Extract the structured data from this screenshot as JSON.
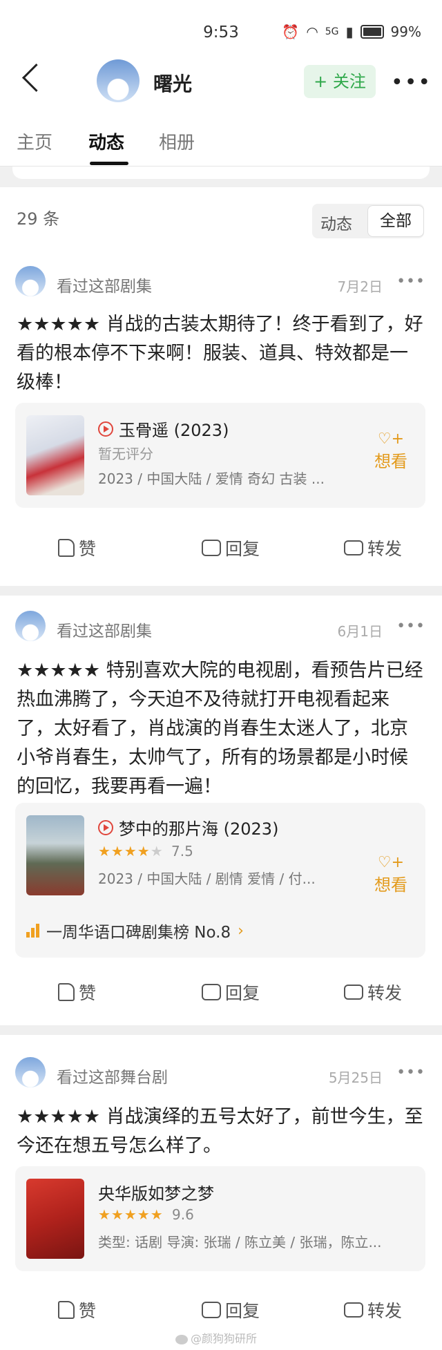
{
  "status_bar": {
    "time": "9:53",
    "signal": "5G",
    "battery": "99%"
  },
  "header": {
    "name": "曙光",
    "follow_label": "+ 关注",
    "tabs": [
      {
        "label": "主页"
      },
      {
        "label": "动态"
      },
      {
        "label": "相册"
      }
    ],
    "active_tab": "动态"
  },
  "feed": {
    "count": "29 条",
    "filters": {
      "option_1": "动态",
      "option_2": "全部"
    }
  },
  "posts": [
    {
      "action": "看过这部剧集",
      "date": "7月2日",
      "text": "★★★★★ 肖战的古装太期待了！终于看到了，好看的根本停不下来啊！服装、道具、特效都是一级棒！",
      "card": {
        "title": "玉骨遥 (2023)",
        "rating_text": "暂无评分",
        "info": "2023 / 中国大陆 / 爱情 奇幻 古装 ...",
        "want_label": "想看"
      },
      "actions": {
        "like": "赞",
        "reply": "回复",
        "share": "转发"
      }
    },
    {
      "action": "看过这部剧集",
      "date": "6月1日",
      "text": "★★★★★ 特别喜欢大院的电视剧，看预告片已经热血沸腾了，今天迫不及待就打开电视看起来了，太好看了，肖战演的肖春生太迷人了，北京小爷肖春生，太帅气了，所有的场景都是小时候的回忆，我要再看一遍！",
      "card": {
        "title": "梦中的那片海 (2023)",
        "stars": 4,
        "score": "7.5",
        "info": "2023 / 中国大陆 / 剧情 爱情 / 付...",
        "want_label": "想看",
        "rank": "一周华语口碑剧集榜 No.8"
      },
      "actions": {
        "like": "赞",
        "reply": "回复",
        "share": "转发"
      }
    },
    {
      "action": "看过这部舞台剧",
      "date": "5月25日",
      "text": "★★★★★ 肖战演绎的五号太好了，前世今生，至今还在想五号怎么样了。",
      "card": {
        "title": "央华版如梦之梦",
        "stars": 5,
        "score": "9.6",
        "info": "类型: 话剧 导演: 张瑞 / 陈立美 / 张瑞，陈立..."
      },
      "actions": {
        "like": "赞",
        "reply": "回复",
        "share": "转发"
      }
    }
  ],
  "watermark": "@颜狗狗研所",
  "colors": {
    "follow_green": "#2fa84a",
    "accent_orange": "#e39a1b",
    "play_red": "#e0463c"
  }
}
